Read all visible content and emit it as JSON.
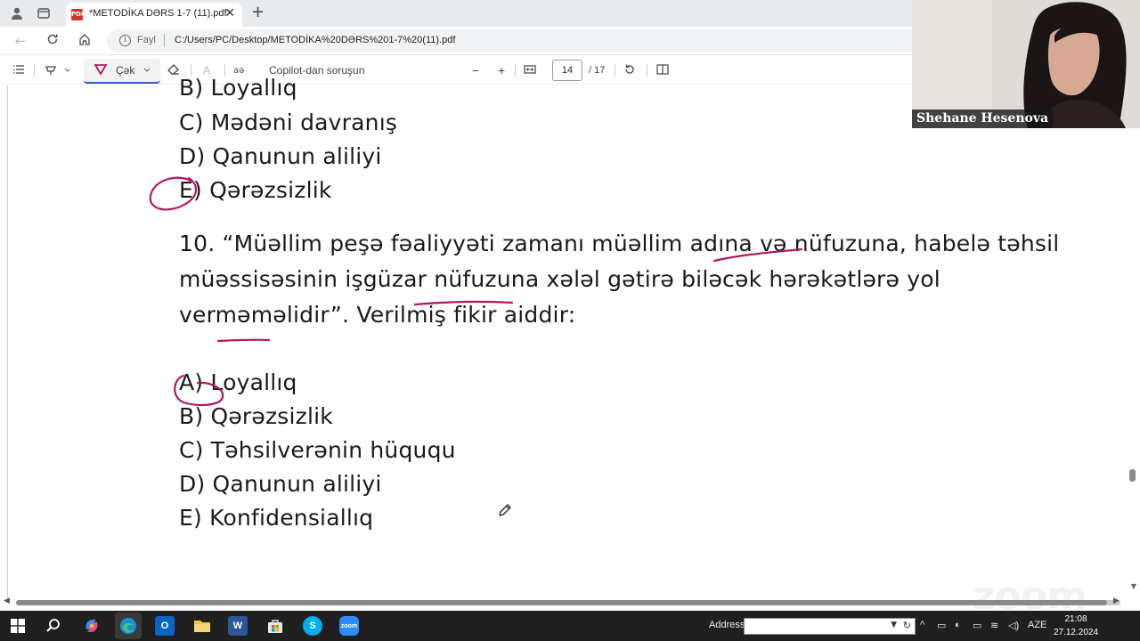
{
  "browser": {
    "tab_title": "*METODİKA DƏRS 1-7 (11).pdf",
    "tab_close": "✕",
    "new_tab": "+",
    "address_scheme": "Fayl",
    "address_url": "C:/Users/PC/Desktop/METODİKA%20DƏRS%201-7%20(11).pdf"
  },
  "pdf_toolbar": {
    "draw_label": "Çək",
    "copilot_label": "Copilot-dan soruşun",
    "zoom_out": "−",
    "zoom_in": "+",
    "page_current": "14",
    "page_total": "/ 17"
  },
  "document": {
    "prev_options": [
      "B) Loyallıq",
      "C) Mədəni davranış",
      "D) Qanunun aliliyi",
      "E) Qərəzsizlik"
    ],
    "question": {
      "line1": "10. “Müəllim peşə fəaliyyəti zamanı müəllim adına və nüfuzuna, habelə təhsil",
      "line2": "müəssisəsinin işgüzar nüfuzuna xələl gətirə biləcək hərəkətlərə yol",
      "line3": "verməməlidir”. Verilmiş fikir aiddir:"
    },
    "options": [
      "A) Loyallıq",
      "B) Qərəzsizlik",
      "C) Təhsilverənin hüququ",
      "D) Qanunun aliliyi",
      "E) Konfidensiallıq"
    ],
    "annotation_color": "#b0175f"
  },
  "watermark": "zoom",
  "webcam": {
    "participant_name": "Shehane Hesenova"
  },
  "taskbar": {
    "address_label": "Address",
    "language": "AZE",
    "time": "21:08",
    "date": "27.12.2024"
  }
}
